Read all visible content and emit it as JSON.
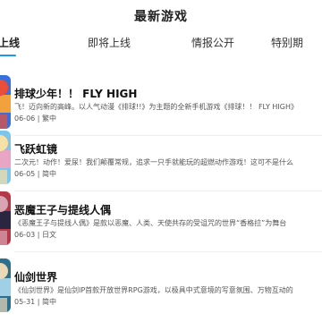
{
  "header": {
    "title": "最新游戏"
  },
  "tabs": [
    {
      "label": "新上线"
    },
    {
      "label": "即将上线"
    },
    {
      "label": "情报公开"
    },
    {
      "label": "特别期"
    }
  ],
  "games": [
    {
      "name": "排球少年！！ FLY HIGH",
      "desc": "飞！迈向新的高峰。以人气动漫《排球!!》为主题的全新手机游戏《排球！！ FLY HIGH》",
      "meta": "06-06 | 繁中",
      "colors": [
        "#3a6fd8",
        "#f2a23c",
        "#e94e3b"
      ]
    },
    {
      "name": "飞跃虹镜",
      "desc": "二次元！动作！爱尿！我们颠覆常规，追求一只手就能玩的超燃动作游戏！这可不是什么",
      "meta": "06-05 | 简中",
      "colors": [
        "#7fc4ea",
        "#e9a6c4",
        "#f6e1a8"
      ]
    },
    {
      "name": "恶魔王子与提线人偶",
      "desc": "《恶魔王子与提线人偶》是款以恶魔、人类、天使共存的受诅咒的世界“香格拉”为舞台",
      "meta": "06-03 | 日文",
      "colors": [
        "#b23a48",
        "#2a2540",
        "#d9a5b3"
      ]
    },
    {
      "name": "仙剑世界",
      "desc": "《仙剑世界》是仙剑IP首款开放世界RPG游戏，以极具中式意境的写意氛围、万物互动的",
      "meta": "05-31 | 简中",
      "colors": [
        "#2e6f8e",
        "#9fd0e6",
        "#e8d9b8"
      ]
    }
  ],
  "accent_color": "#2196f3"
}
